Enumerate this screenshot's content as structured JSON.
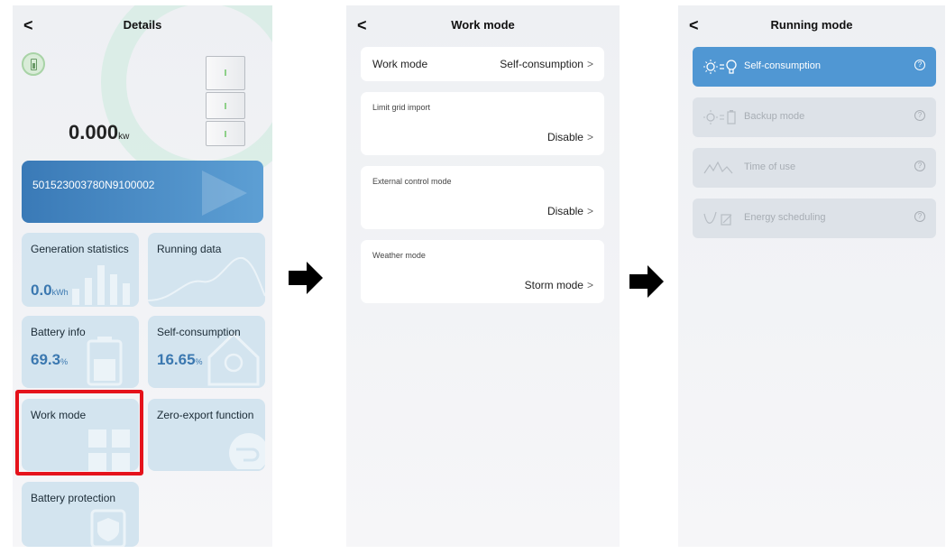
{
  "screen1": {
    "back_icon": "<",
    "title": "Details",
    "power": {
      "value": "0.000",
      "unit": "kw"
    },
    "serial": "501523003780N9100002",
    "tiles": [
      {
        "title": "Generation statistics",
        "value": "0.0",
        "unit": "kWh"
      },
      {
        "title": "Running data"
      },
      {
        "title": "Battery info",
        "value": "69.3",
        "unit": "%"
      },
      {
        "title": "Self-consumption",
        "value": "16.65",
        "unit": "%"
      },
      {
        "title": "Work mode"
      },
      {
        "title": "Zero-export function"
      },
      {
        "title": "Battery protection"
      }
    ],
    "highlight_color": "#e5121b"
  },
  "screen2": {
    "back_icon": "<",
    "title": "Work mode",
    "work_mode": {
      "label": "Work mode",
      "value": "Self-consumption"
    },
    "items": [
      {
        "label": "Limit grid import",
        "value": "Disable"
      },
      {
        "label": "External control mode",
        "value": "Disable"
      },
      {
        "label": "Weather mode",
        "value": "Storm mode"
      }
    ],
    "chevron": ">"
  },
  "screen3": {
    "back_icon": "<",
    "title": "Running mode",
    "modes": [
      {
        "label": "Self-consumption",
        "active": true,
        "icon": "sun-bulb-icon"
      },
      {
        "label": "Backup mode",
        "active": false,
        "icon": "sun-battery-icon"
      },
      {
        "label": "Time of use",
        "active": false,
        "icon": "price-curve-icon"
      },
      {
        "label": "Energy scheduling",
        "active": false,
        "icon": "schedule-curve-icon"
      }
    ],
    "help_icon": "?",
    "accent_color": "#5097d3"
  }
}
